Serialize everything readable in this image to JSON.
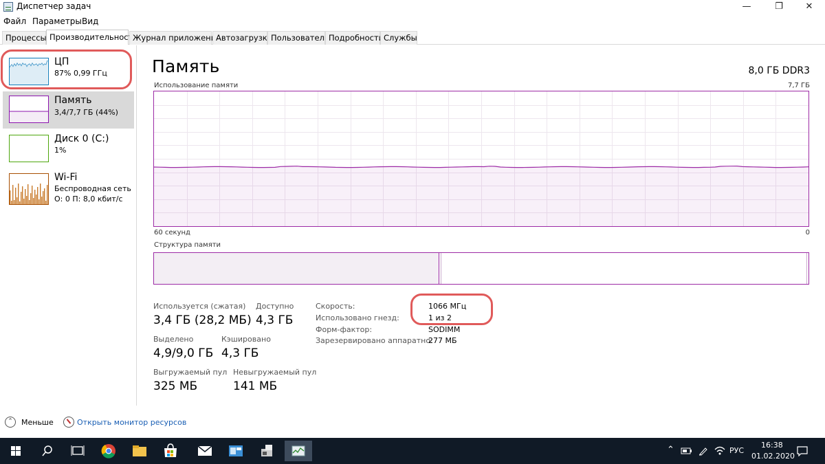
{
  "window": {
    "title": "Диспетчер задач",
    "minimize_glyph": "—",
    "maximize_glyph": "❐",
    "close_glyph": "✕"
  },
  "menu": [
    "Файл",
    "Параметры",
    "Вид"
  ],
  "tabs": [
    "Процессы",
    "Производительность",
    "Журнал приложений",
    "Автозагрузка",
    "Пользователи",
    "Подробности",
    "Службы"
  ],
  "active_tab": "Производительность",
  "sidebar": {
    "items": [
      {
        "name": "ЦП",
        "sub1": "87%  0,99 ГГц",
        "sub2": "",
        "color": "#117dbb"
      },
      {
        "name": "Память",
        "sub1": "3,4/7,7 ГБ (44%)",
        "sub2": "",
        "color": "#8b12ae"
      },
      {
        "name": "Диск 0 (C:)",
        "sub1": "1%",
        "sub2": "",
        "color": "#4da60c"
      },
      {
        "name": "Wi-Fi",
        "sub1": "Беспроводная сеть",
        "sub2": "О: 0 П: 8,0 кбит/с",
        "color": "#a74f01"
      }
    ],
    "selected_index": 1
  },
  "main": {
    "title": "Память",
    "spec": "8,0 ГБ DDR3",
    "usage_label": "Использование памяти",
    "usage_max": "7,7 ГБ",
    "time_left": "60 секунд",
    "time_right": "0",
    "usage_fraction": 0.44,
    "composition_label": "Структура памяти",
    "accent": "#9c2aa5"
  },
  "stats": {
    "in_use_label": "Используется (сжатая)",
    "in_use_value": "3,4 ГБ (28,2 МБ)",
    "available_label": "Доступно",
    "available_value": "4,3 ГБ",
    "committed_label": "Выделено",
    "committed_value": "4,9/9,0 ГБ",
    "cached_label": "Кэшировано",
    "cached_value": "4,3 ГБ",
    "paged_label": "Выгружаемый пул",
    "paged_value": "325 МБ",
    "nonpaged_label": "Невыгружаемый пул",
    "nonpaged_value": "141 МБ"
  },
  "properties": [
    {
      "label": "Скорость:",
      "value": "1066 МГц"
    },
    {
      "label": "Использовано гнезд:",
      "value": "1 из 2"
    },
    {
      "label": "Форм-фактор:",
      "value": "SODIMM"
    },
    {
      "label": "Зарезервировано аппаратно:",
      "value": "277 МБ"
    }
  ],
  "footer": {
    "less_label": "Меньше",
    "resmon_label": "Открыть монитор ресурсов"
  },
  "taskbar": {
    "icons": [
      "windows-start-icon",
      "search-icon",
      "task-view-icon",
      "chrome-icon",
      "file-explorer-icon",
      "store-icon",
      "mail-icon",
      "app-icon",
      "app2-icon",
      "task-manager-icon"
    ],
    "lang": "РУС",
    "time": "16:38",
    "date": "01.02.2020"
  }
}
